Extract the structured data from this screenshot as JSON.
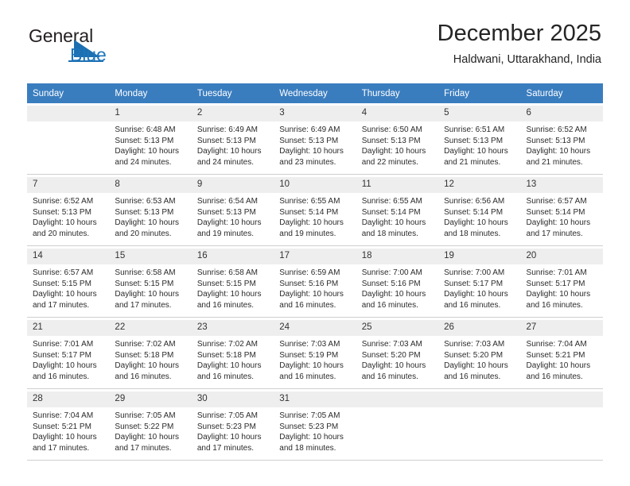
{
  "brand": {
    "name_part1": "General",
    "name_part2": "Blue",
    "accent_color": "#1c6fb0"
  },
  "header": {
    "title": "December 2025",
    "location": "Haldwani, Uttarakhand, India",
    "header_bg_color": "#3a7dbf"
  },
  "weekdays": [
    "Sunday",
    "Monday",
    "Tuesday",
    "Wednesday",
    "Thursday",
    "Friday",
    "Saturday"
  ],
  "labels": {
    "sunrise": "Sunrise:",
    "sunset": "Sunset:",
    "daylight": "Daylight:"
  },
  "weeks": [
    {
      "shaded": true,
      "days": [
        {
          "num": "",
          "sunrise": "",
          "sunset": "",
          "daylight1": "",
          "daylight2": ""
        },
        {
          "num": "1",
          "sunrise": "Sunrise: 6:48 AM",
          "sunset": "Sunset: 5:13 PM",
          "daylight1": "Daylight: 10 hours",
          "daylight2": "and 24 minutes."
        },
        {
          "num": "2",
          "sunrise": "Sunrise: 6:49 AM",
          "sunset": "Sunset: 5:13 PM",
          "daylight1": "Daylight: 10 hours",
          "daylight2": "and 24 minutes."
        },
        {
          "num": "3",
          "sunrise": "Sunrise: 6:49 AM",
          "sunset": "Sunset: 5:13 PM",
          "daylight1": "Daylight: 10 hours",
          "daylight2": "and 23 minutes."
        },
        {
          "num": "4",
          "sunrise": "Sunrise: 6:50 AM",
          "sunset": "Sunset: 5:13 PM",
          "daylight1": "Daylight: 10 hours",
          "daylight2": "and 22 minutes."
        },
        {
          "num": "5",
          "sunrise": "Sunrise: 6:51 AM",
          "sunset": "Sunset: 5:13 PM",
          "daylight1": "Daylight: 10 hours",
          "daylight2": "and 21 minutes."
        },
        {
          "num": "6",
          "sunrise": "Sunrise: 6:52 AM",
          "sunset": "Sunset: 5:13 PM",
          "daylight1": "Daylight: 10 hours",
          "daylight2": "and 21 minutes."
        }
      ]
    },
    {
      "shaded": true,
      "days": [
        {
          "num": "7",
          "sunrise": "Sunrise: 6:52 AM",
          "sunset": "Sunset: 5:13 PM",
          "daylight1": "Daylight: 10 hours",
          "daylight2": "and 20 minutes."
        },
        {
          "num": "8",
          "sunrise": "Sunrise: 6:53 AM",
          "sunset": "Sunset: 5:13 PM",
          "daylight1": "Daylight: 10 hours",
          "daylight2": "and 20 minutes."
        },
        {
          "num": "9",
          "sunrise": "Sunrise: 6:54 AM",
          "sunset": "Sunset: 5:13 PM",
          "daylight1": "Daylight: 10 hours",
          "daylight2": "and 19 minutes."
        },
        {
          "num": "10",
          "sunrise": "Sunrise: 6:55 AM",
          "sunset": "Sunset: 5:14 PM",
          "daylight1": "Daylight: 10 hours",
          "daylight2": "and 19 minutes."
        },
        {
          "num": "11",
          "sunrise": "Sunrise: 6:55 AM",
          "sunset": "Sunset: 5:14 PM",
          "daylight1": "Daylight: 10 hours",
          "daylight2": "and 18 minutes."
        },
        {
          "num": "12",
          "sunrise": "Sunrise: 6:56 AM",
          "sunset": "Sunset: 5:14 PM",
          "daylight1": "Daylight: 10 hours",
          "daylight2": "and 18 minutes."
        },
        {
          "num": "13",
          "sunrise": "Sunrise: 6:57 AM",
          "sunset": "Sunset: 5:14 PM",
          "daylight1": "Daylight: 10 hours",
          "daylight2": "and 17 minutes."
        }
      ]
    },
    {
      "shaded": true,
      "days": [
        {
          "num": "14",
          "sunrise": "Sunrise: 6:57 AM",
          "sunset": "Sunset: 5:15 PM",
          "daylight1": "Daylight: 10 hours",
          "daylight2": "and 17 minutes."
        },
        {
          "num": "15",
          "sunrise": "Sunrise: 6:58 AM",
          "sunset": "Sunset: 5:15 PM",
          "daylight1": "Daylight: 10 hours",
          "daylight2": "and 17 minutes."
        },
        {
          "num": "16",
          "sunrise": "Sunrise: 6:58 AM",
          "sunset": "Sunset: 5:15 PM",
          "daylight1": "Daylight: 10 hours",
          "daylight2": "and 16 minutes."
        },
        {
          "num": "17",
          "sunrise": "Sunrise: 6:59 AM",
          "sunset": "Sunset: 5:16 PM",
          "daylight1": "Daylight: 10 hours",
          "daylight2": "and 16 minutes."
        },
        {
          "num": "18",
          "sunrise": "Sunrise: 7:00 AM",
          "sunset": "Sunset: 5:16 PM",
          "daylight1": "Daylight: 10 hours",
          "daylight2": "and 16 minutes."
        },
        {
          "num": "19",
          "sunrise": "Sunrise: 7:00 AM",
          "sunset": "Sunset: 5:17 PM",
          "daylight1": "Daylight: 10 hours",
          "daylight2": "and 16 minutes."
        },
        {
          "num": "20",
          "sunrise": "Sunrise: 7:01 AM",
          "sunset": "Sunset: 5:17 PM",
          "daylight1": "Daylight: 10 hours",
          "daylight2": "and 16 minutes."
        }
      ]
    },
    {
      "shaded": true,
      "days": [
        {
          "num": "21",
          "sunrise": "Sunrise: 7:01 AM",
          "sunset": "Sunset: 5:17 PM",
          "daylight1": "Daylight: 10 hours",
          "daylight2": "and 16 minutes."
        },
        {
          "num": "22",
          "sunrise": "Sunrise: 7:02 AM",
          "sunset": "Sunset: 5:18 PM",
          "daylight1": "Daylight: 10 hours",
          "daylight2": "and 16 minutes."
        },
        {
          "num": "23",
          "sunrise": "Sunrise: 7:02 AM",
          "sunset": "Sunset: 5:18 PM",
          "daylight1": "Daylight: 10 hours",
          "daylight2": "and 16 minutes."
        },
        {
          "num": "24",
          "sunrise": "Sunrise: 7:03 AM",
          "sunset": "Sunset: 5:19 PM",
          "daylight1": "Daylight: 10 hours",
          "daylight2": "and 16 minutes."
        },
        {
          "num": "25",
          "sunrise": "Sunrise: 7:03 AM",
          "sunset": "Sunset: 5:20 PM",
          "daylight1": "Daylight: 10 hours",
          "daylight2": "and 16 minutes."
        },
        {
          "num": "26",
          "sunrise": "Sunrise: 7:03 AM",
          "sunset": "Sunset: 5:20 PM",
          "daylight1": "Daylight: 10 hours",
          "daylight2": "and 16 minutes."
        },
        {
          "num": "27",
          "sunrise": "Sunrise: 7:04 AM",
          "sunset": "Sunset: 5:21 PM",
          "daylight1": "Daylight: 10 hours",
          "daylight2": "and 16 minutes."
        }
      ]
    },
    {
      "shaded": true,
      "days": [
        {
          "num": "28",
          "sunrise": "Sunrise: 7:04 AM",
          "sunset": "Sunset: 5:21 PM",
          "daylight1": "Daylight: 10 hours",
          "daylight2": "and 17 minutes."
        },
        {
          "num": "29",
          "sunrise": "Sunrise: 7:05 AM",
          "sunset": "Sunset: 5:22 PM",
          "daylight1": "Daylight: 10 hours",
          "daylight2": "and 17 minutes."
        },
        {
          "num": "30",
          "sunrise": "Sunrise: 7:05 AM",
          "sunset": "Sunset: 5:23 PM",
          "daylight1": "Daylight: 10 hours",
          "daylight2": "and 17 minutes."
        },
        {
          "num": "31",
          "sunrise": "Sunrise: 7:05 AM",
          "sunset": "Sunset: 5:23 PM",
          "daylight1": "Daylight: 10 hours",
          "daylight2": "and 18 minutes."
        },
        {
          "num": "",
          "sunrise": "",
          "sunset": "",
          "daylight1": "",
          "daylight2": ""
        },
        {
          "num": "",
          "sunrise": "",
          "sunset": "",
          "daylight1": "",
          "daylight2": ""
        },
        {
          "num": "",
          "sunrise": "",
          "sunset": "",
          "daylight1": "",
          "daylight2": ""
        }
      ]
    }
  ]
}
